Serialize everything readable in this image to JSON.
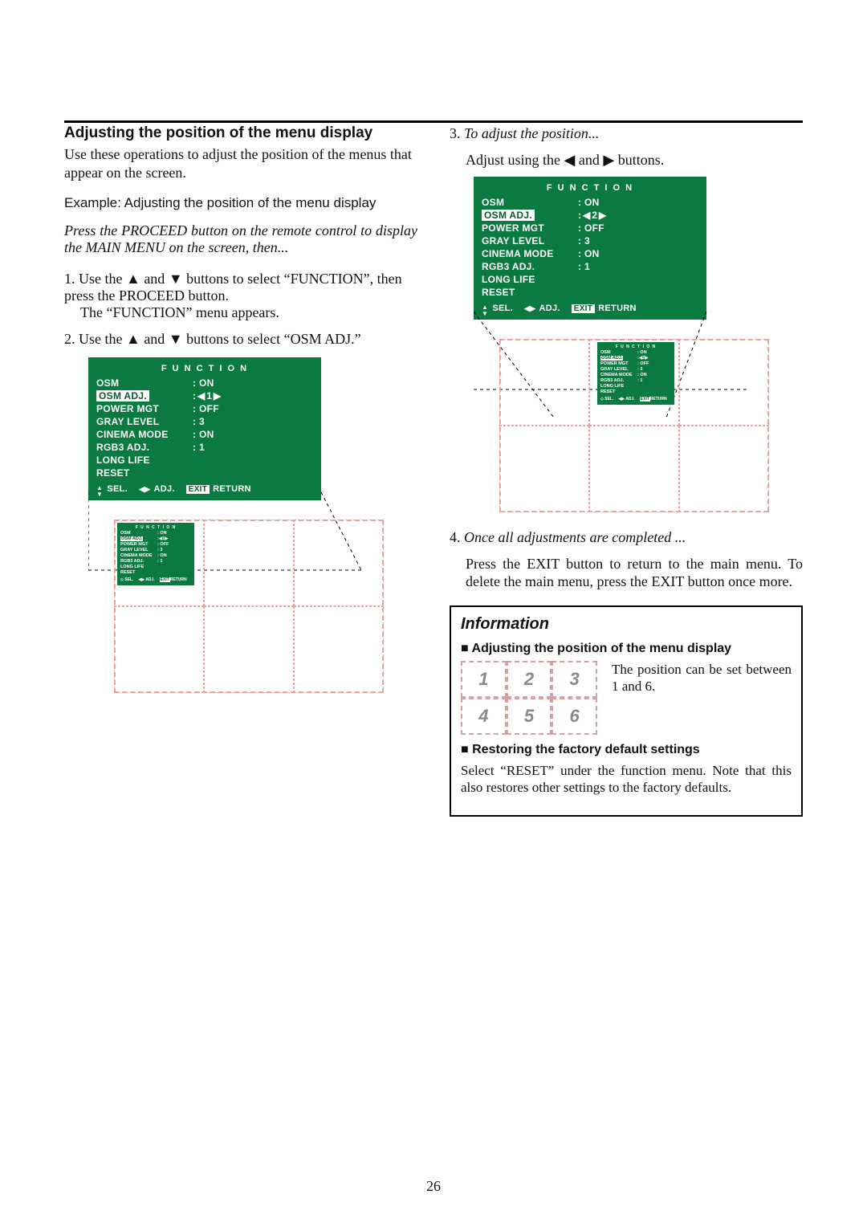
{
  "page_number": "26",
  "left": {
    "heading": "Adjusting the position of the menu display",
    "intro": "Use these operations to adjust the position of the menus that appear on the screen.",
    "example": "Example: Adjusting the position of the menu display",
    "proceed_note": "Press the PROCEED button on the remote control to display the MAIN MENU on the screen, then...",
    "step1_a": "1. Use the ",
    "step1_b": " and ",
    "step1_c": " buttons to select “FUNCTION”, then press the PROCEED button.",
    "step1_d": "The “FUNCTION” menu appears.",
    "step2_a": "2. Use the ",
    "step2_b": " and ",
    "step2_c": " buttons to select “OSM ADJ.”"
  },
  "right": {
    "step3_n": "3. ",
    "step3_title": "To adjust the position...",
    "step3_a": "Adjust using the ",
    "step3_b": " and ",
    "step3_c": " buttons.",
    "step4_n": "4. ",
    "step4_title": "Once all adjustments are completed ...",
    "step4_body": "Press the EXIT button to return to the main menu. To delete the main menu, press the EXIT button once more."
  },
  "osd": {
    "title": "F U N C T I O N",
    "items": [
      {
        "label": "OSM",
        "value": "ON"
      },
      {
        "label": "OSM ADJ.",
        "value_left": "1",
        "selected": true
      },
      {
        "label": "POWER MGT",
        "value": "OFF"
      },
      {
        "label": "GRAY LEVEL",
        "value": "3"
      },
      {
        "label": "CINEMA MODE",
        "value": "ON"
      },
      {
        "label": "RGB3 ADJ.",
        "value": "1"
      },
      {
        "label": "LONG LIFE"
      },
      {
        "label": "RESET"
      }
    ],
    "bar_sel": "SEL.",
    "bar_adj": "ADJ.",
    "bar_return": "RETURN",
    "bar_exit": "EXIT"
  },
  "osd2_value": "2",
  "mini_pos_left": "top-left",
  "mini_pos_right": "center",
  "info": {
    "title": "Information",
    "sub1": "Adjusting the position of the menu display",
    "body1": "The position can be set between 1 and 6.",
    "cells": [
      "1",
      "2",
      "3",
      "4",
      "5",
      "6"
    ],
    "sub2": "Restoring the factory default settings",
    "body2": "Select “RESET” under the function menu. Note that this also restores other settings to the factory defaults."
  },
  "glyphs": {
    "up": "▲",
    "down": "▼",
    "left": "◀",
    "right": "▶"
  }
}
